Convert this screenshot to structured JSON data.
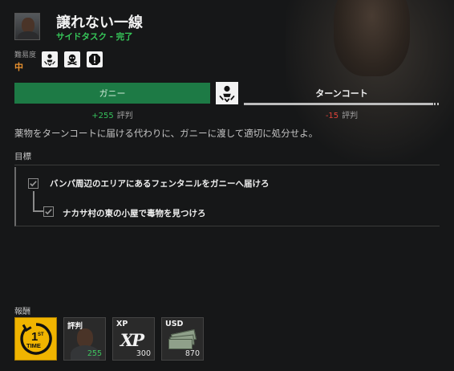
{
  "header": {
    "title": "譲れない一線",
    "subtitle_type": "サイドタスク",
    "subtitle_sep": " - ",
    "subtitle_status": "完了"
  },
  "difficulty": {
    "label": "難易度",
    "value": "中"
  },
  "tags": [
    {
      "icon": "choice-person-icon"
    },
    {
      "icon": "skull-crossbones-icon"
    },
    {
      "icon": "alert-octagon-icon"
    }
  ],
  "choice": {
    "left_label": "ガニー",
    "right_label": "ターンコート",
    "left_reputation": "+255",
    "right_reputation": "-15",
    "reputation_unit": "評判",
    "selected": "ガニー"
  },
  "description": "薬物をターンコートに届ける代わりに、ガニーに渡して適切に処分せよ。",
  "objectives": {
    "heading": "目標",
    "items": [
      {
        "text": "バンパ周辺のエリアにあるフェンタニルをガニーへ届けろ",
        "done": true
      },
      {
        "text": "ナカサ村の東の小屋で毒物を見つけろ",
        "done": true
      }
    ]
  },
  "rewards": {
    "heading": "報酬",
    "items": [
      {
        "type": "first-time",
        "name": "",
        "amount": ""
      },
      {
        "type": "reputation",
        "name": "評判",
        "amount": "255"
      },
      {
        "type": "xp",
        "name": "XP",
        "amount": "300"
      },
      {
        "type": "usd",
        "name": "USD",
        "amount": "870"
      }
    ]
  },
  "colors": {
    "accent_green": "#1d7a45",
    "status_green": "#36c759",
    "difficulty_orange": "#e8902e",
    "negative_red": "#e0443a",
    "first_time_gold": "#f0b400"
  }
}
